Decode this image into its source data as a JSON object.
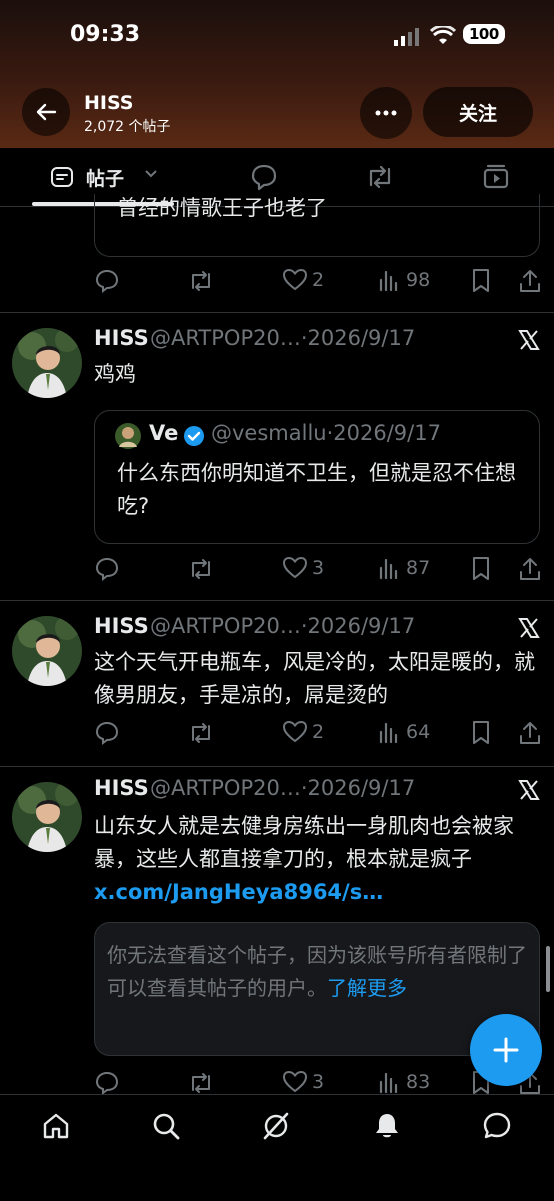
{
  "status": {
    "time": "09:33",
    "battery": "100"
  },
  "profile": {
    "name": "HISS",
    "post_count": "2,072 个帖子",
    "follow_label": "关注"
  },
  "tabs": {
    "active_label": "帖子"
  },
  "posts": [
    {
      "text": "曾经的情歌王子也老了",
      "likes": "2",
      "views": "98"
    },
    {
      "name": "HISS",
      "meta": "@ARTPOP20…·2026/9/17",
      "text": "鸡鸡",
      "quote": {
        "name": "Ve",
        "meta": "@vesmallu·2026/9/17",
        "text": "什么东西你明知道不卫生，但就是忍不住想吃?"
      },
      "likes": "3",
      "views": "87"
    },
    {
      "name": "HISS",
      "meta": "@ARTPOP20…·2026/9/17",
      "text": "这个天气开电瓶车，风是冷的，太阳是暖的，就像男朋友，手是凉的，屌是烫的",
      "likes": "2",
      "views": "64"
    },
    {
      "name": "HISS",
      "meta": "@ARTPOP20…·2026/9/17",
      "text": "山东女人就是去健身房练出一身肌肉也会被家暴，这些人都直接拿刀的，根本就是疯子",
      "link": "x.com/JangHeya8964/s…",
      "notice": "你无法查看这个帖子，因为该账号所有者限制了可以查看其帖子的用户。",
      "notice_link": "了解更多",
      "likes": "3",
      "views": "83"
    }
  ],
  "colors": {
    "accent": "#1d9bf0",
    "muted": "#71767b",
    "text": "#e7e9ea",
    "background": "#000000"
  }
}
